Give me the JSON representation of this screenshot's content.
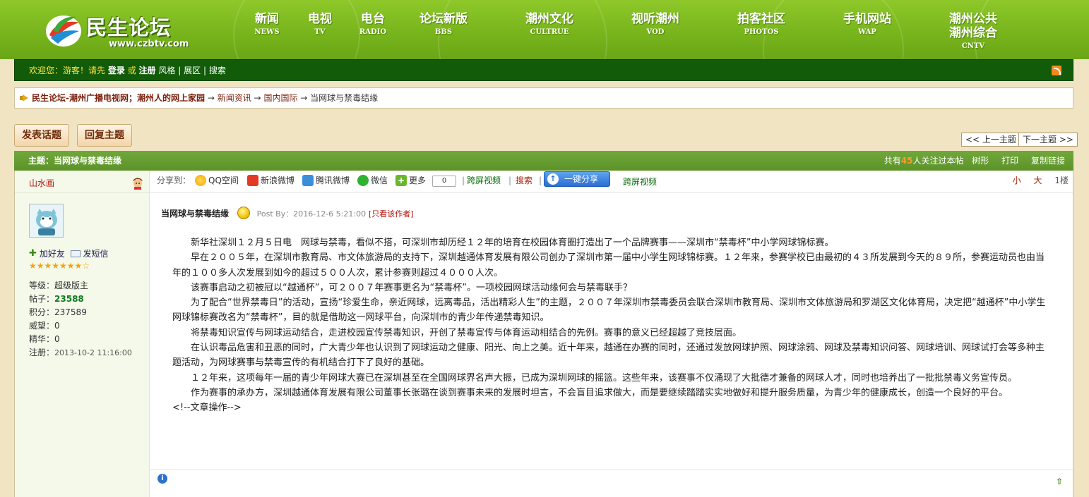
{
  "header": {
    "logo_text": "民生论坛",
    "logo_url": "www.czbtv.com",
    "nav": [
      {
        "cn": "新闻",
        "en": "NEWS"
      },
      {
        "cn": "电视",
        "en": "TV"
      },
      {
        "cn": "电台",
        "en": "RADIO"
      },
      {
        "cn": "论坛新版",
        "en": "BBS"
      },
      {
        "cn": "潮州文化",
        "en": "CULTRUE"
      },
      {
        "cn": "视听潮州",
        "en": "VOD"
      },
      {
        "cn": "拍客社区",
        "en": "PHOTOS"
      },
      {
        "cn": "手机网站",
        "en": "WAP"
      },
      {
        "cn": "潮州公共\n潮州综合",
        "en": "CNTV"
      }
    ]
  },
  "userbar": {
    "welcome": "欢迎您：游客！请先",
    "login": "登录",
    "or": "或",
    "register": "注册",
    "style": "风格",
    "sep1": "|",
    "exhibition": "展区",
    "sep2": "|",
    "search": "搜索"
  },
  "breadcrumb": {
    "home": "民生论坛-潮州广播电视网；潮州人的网上家园",
    "arrow": "→",
    "level1": "新闻资讯",
    "level2": "国内国际",
    "current": "当网球与禁毒结缘"
  },
  "actions": {
    "new_topic": "发表话题",
    "reply": "回复主题",
    "prev": "<< 上一主题",
    "next": "下一主题 >>"
  },
  "thread": {
    "title_prefix": "主题：",
    "title": "当网球与禁毒结缘",
    "watch_prefix": "共有",
    "watch_count": "45",
    "watch_suffix": "人关注过本帖",
    "tree": "树形",
    "print": "打印",
    "copy_link": "复制链接"
  },
  "author": {
    "name": "山水画",
    "add_friend": "加好友",
    "send_msg": "发短信",
    "stars": "★★★★★★★☆",
    "level_label": "等级：",
    "level": "超级版主",
    "posts_label": "帖子：",
    "posts": "23588",
    "points_label": "积分：",
    "points": "237589",
    "prestige_label": "威望：",
    "prestige": "0",
    "elite_label": "精华：",
    "elite": "0",
    "reg_label": "注册：",
    "reg_date": "2013-10-2 11:16:00"
  },
  "share": {
    "label": "分享到：",
    "qzone": "QQ空间",
    "weibo": "新浪微博",
    "tweibo": "腾讯微博",
    "wechat": "微信",
    "more": "更多",
    "count": "0",
    "cross_video1": "跨屏视频",
    "search": "搜索",
    "one_click": "一键分享",
    "cross_video2": "跨屏视频",
    "font_small": "小",
    "font_large": "大",
    "floor": "1楼"
  },
  "post": {
    "title": "当网球与禁毒结缘",
    "meta": "Post By：2016-12-6 5:21:00",
    "only_author": "[只看该作者]",
    "paragraphs": [
      "新华社深圳１２月５日电　网球与禁毒，看似不搭，可深圳市却历经１２年的培育在校园体育圈打造出了一个品牌赛事——深圳市“禁毒杯”中小学网球锦标赛。",
      "早在２００５年，在深圳市教育局、市文体旅游局的支持下，深圳越通体育发展有限公司创办了深圳市第一届中小学生网球锦标赛。１２年来，参赛学校已由最初的４３所发展到今天的８９所，参赛运动员也由当年的１００多人次发展到如今的超过５００人次，累计参赛则超过４０００人次。",
      "该赛事启动之初被冠以“越通杯”，可２００７年赛事更名为“禁毒杯”。一项校园网球活动缘何会与禁毒联手？",
      "为了配合“世界禁毒日”的活动，宣扬“珍爱生命，亲近网球，远离毒品，活出精彩人生”的主题，２００７年深圳市禁毒委员会联合深圳市教育局、深圳市文体旅游局和罗湖区文化体育局，决定把“越通杯”中小学生网球锦标赛改名为“禁毒杯”，目的就是借助这一网球平台，向深圳市的青少年传递禁毒知识。",
      "将禁毒知识宣传与网球运动结合，走进校园宣传禁毒知识，开创了禁毒宣传与体育运动相结合的先例。赛事的意义已经超越了竞技层面。",
      "在认识毒品危害和丑恶的同时，广大青少年也认识到了网球运动之健康、阳光、向上之美。近十年来，越通在办赛的同时，还通过发放网球护照、网球涂鸦、网球及禁毒知识问答、网球培训、网球试打会等多种主题活动，为网球赛事与禁毒宣传的有机结合打下了良好的基础。",
      "１２年来，这项每年一届的青少年网球大赛已在深圳甚至在全国网球界名声大振，已成为深圳网球的摇篮。这些年来，该赛事不仅涌现了大批德才兼备的网球人才，同时也培养出了一批批禁毒义务宣传员。",
      "作为赛事的承办方，深圳越通体育发展有限公司董事长张璐在谈到赛事未来的发展时坦言，不会盲目追求做大，而是要继续踏踏实实地做好和提升服务质量，为青少年的健康成长，创造一个良好的平台。"
    ],
    "comment": "<!--文章操作-->"
  },
  "colors": {
    "header_green": "#7cba1f",
    "userbar_green": "#115b09",
    "thread_bar": "#5f942b",
    "page_bg": "#f1e4c3",
    "author_red": "#b3120a",
    "watch_orange": "#ff9a2e"
  },
  "icons": [
    "logo-emblem-icon",
    "rss-icon",
    "breadcrumb-arrow-icon",
    "gender-icon",
    "plus-icon",
    "mail-icon",
    "qzone-icon",
    "weibo-icon",
    "tweibo-icon",
    "wechat-icon",
    "more-share-icon",
    "smile-icon",
    "info-icon",
    "top-icon"
  ]
}
